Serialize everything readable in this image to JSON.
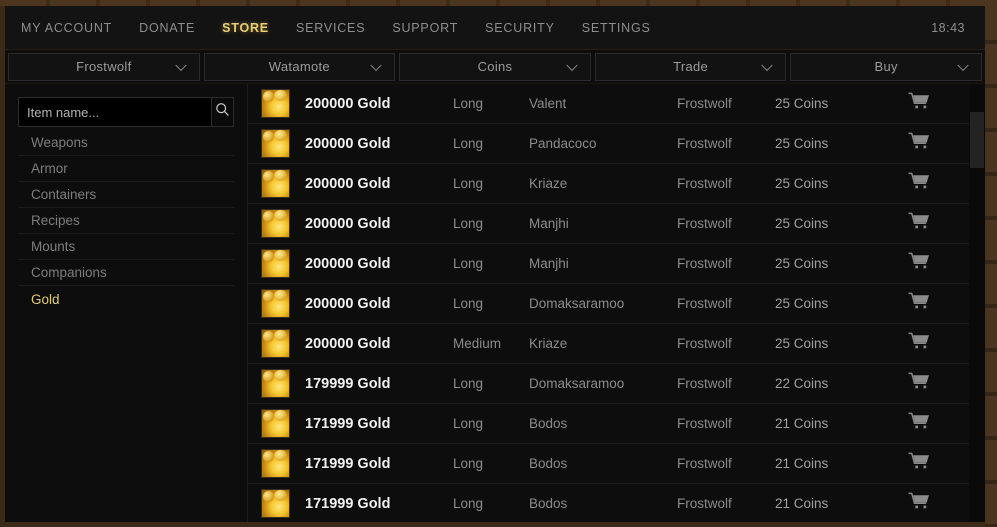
{
  "topnav": {
    "items": [
      {
        "label": "MY ACCOUNT",
        "active": false
      },
      {
        "label": "DONATE",
        "active": false
      },
      {
        "label": "STORE",
        "active": true
      },
      {
        "label": "SERVICES",
        "active": false
      },
      {
        "label": "SUPPORT",
        "active": false
      },
      {
        "label": "SECURITY",
        "active": false
      },
      {
        "label": "SETTINGS",
        "active": false
      }
    ],
    "clock": "18:43"
  },
  "filters": [
    {
      "name": "realm-filter",
      "value": "Frostwolf"
    },
    {
      "name": "guild-filter",
      "value": "Watamote"
    },
    {
      "name": "currency-filter",
      "value": "Coins"
    },
    {
      "name": "trade-filter",
      "value": "Trade"
    },
    {
      "name": "action-filter",
      "value": "Buy"
    }
  ],
  "sidebar": {
    "search": {
      "placeholder": "Item name...",
      "value": "",
      "icon": "search-icon"
    },
    "categories": [
      {
        "label": "Weapons",
        "active": false
      },
      {
        "label": "Armor",
        "active": false
      },
      {
        "label": "Containers",
        "active": false
      },
      {
        "label": "Recipes",
        "active": false
      },
      {
        "label": "Mounts",
        "active": false
      },
      {
        "label": "Companions",
        "active": false
      },
      {
        "label": "Gold",
        "active": true
      }
    ]
  },
  "table": {
    "cart_icon": "shopping-cart-icon",
    "item_icon": "gold-coins-icon",
    "rows": [
      {
        "item": "200000 Gold",
        "duration": "Long",
        "seller": "Valent",
        "realm": "Frostwolf",
        "price": "25 Coins"
      },
      {
        "item": "200000 Gold",
        "duration": "Long",
        "seller": "Pandacoco",
        "realm": "Frostwolf",
        "price": "25 Coins"
      },
      {
        "item": "200000 Gold",
        "duration": "Long",
        "seller": "Kriaze",
        "realm": "Frostwolf",
        "price": "25 Coins"
      },
      {
        "item": "200000 Gold",
        "duration": "Long",
        "seller": "Manjhi",
        "realm": "Frostwolf",
        "price": "25 Coins"
      },
      {
        "item": "200000 Gold",
        "duration": "Long",
        "seller": "Manjhi",
        "realm": "Frostwolf",
        "price": "25 Coins"
      },
      {
        "item": "200000 Gold",
        "duration": "Long",
        "seller": "Domaksaramoo",
        "realm": "Frostwolf",
        "price": "25 Coins"
      },
      {
        "item": "200000 Gold",
        "duration": "Medium",
        "seller": "Kriaze",
        "realm": "Frostwolf",
        "price": "25 Coins"
      },
      {
        "item": "179999 Gold",
        "duration": "Long",
        "seller": "Domaksaramoo",
        "realm": "Frostwolf",
        "price": "22 Coins"
      },
      {
        "item": "171999 Gold",
        "duration": "Long",
        "seller": "Bodos",
        "realm": "Frostwolf",
        "price": "21 Coins"
      },
      {
        "item": "171999 Gold",
        "duration": "Long",
        "seller": "Bodos",
        "realm": "Frostwolf",
        "price": "21 Coins"
      },
      {
        "item": "171999 Gold",
        "duration": "Long",
        "seller": "Bodos",
        "realm": "Frostwolf",
        "price": "21 Coins"
      }
    ]
  },
  "colors": {
    "accent": "#e8cf74",
    "panel_bg": "#0d0d0d",
    "frame": "#3b2a18",
    "muted_text": "#8c8c8c"
  }
}
